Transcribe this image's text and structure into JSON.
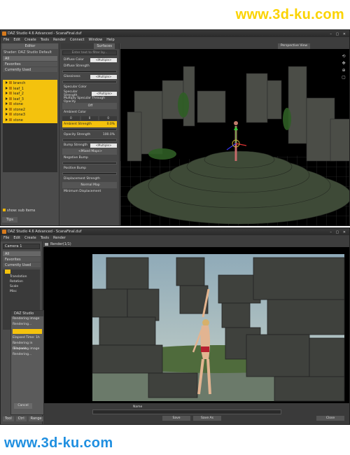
{
  "watermark_top": "www.3d-ku.com",
  "watermark_bottom": "www.3d-ku.com",
  "shot1": {
    "window_title": "DAZ Studio 4.6 Advanced - ScanaFinal.duf",
    "menu": [
      "File",
      "Edit",
      "Create",
      "Tools",
      "Render",
      "Connect",
      "Window",
      "Help"
    ],
    "left_panel": {
      "tab": "Editor",
      "shader_label": "Shader: DAZ Studio Default",
      "filters": [
        "All",
        "Favorites",
        "Currently Used"
      ],
      "tree_items": [
        "branch",
        "leaf_1",
        "leaf_2",
        "leaf_3",
        "stone",
        "stone2",
        "stone3",
        "stone"
      ],
      "footer_check": "show: sub items",
      "bottom_tab": "Tips"
    },
    "surfaces_panel": {
      "tab": "Surfaces",
      "search_placeholder": "Enter text to filter by...",
      "props": [
        {
          "label": "Diffuse Color",
          "value": "<Multiple>"
        },
        {
          "label": "Diffuse Strength",
          "value": ""
        },
        {
          "label": "Glossiness",
          "value": "<Multiple>"
        },
        {
          "label": "Specular Color",
          "value": ""
        },
        {
          "label": "Specular Strength",
          "value": "<Multiple>"
        },
        {
          "label": "Multiply Specular Through Opacity",
          "value": ""
        },
        {
          "label": "Ambient Color",
          "value": ""
        },
        {
          "label": "Ambient Strength",
          "value": "0.0%"
        },
        {
          "label": "Opacity Strength",
          "value": "100.0%"
        },
        {
          "label": "Bump Strength",
          "value": "<Multiple>"
        },
        {
          "label": "Negative Bump",
          "value": ""
        },
        {
          "label": "Positive Bump",
          "value": ""
        },
        {
          "label": "Displacement Strength",
          "value": ""
        },
        {
          "label": "Minimum Displacement",
          "value": ""
        }
      ],
      "ambient_rgb": [
        "0",
        "0",
        "0"
      ],
      "group_off": "Off",
      "group_bump": "<Mixed Maps>",
      "group_normal": "Normal Map"
    },
    "viewport": {
      "view_menu": "Perspective View"
    }
  },
  "shot2": {
    "window_title": "DAZ Studio 4.6 Advanced - ScanaFinal.duf",
    "menu": [
      "File",
      "Edit",
      "Create",
      "Tools",
      "Render"
    ],
    "left_panel": {
      "camera_dropdown": "Camera 1",
      "filters": [
        "All",
        "Favorites",
        "Currently Used"
      ],
      "scene_items": [
        "Translation",
        "Rotation",
        "Scale",
        "Misc"
      ],
      "bottom_tabs": [
        "Tool",
        "Ctrl",
        "Range"
      ]
    },
    "render_dialog": {
      "title": "DAZ Studio",
      "line1": "Rendering image",
      "line2": "Rendering...",
      "elapsed": "Elapsed Time: 1h ...",
      "log1": "Rendering in (Elapsed...",
      "log2": "Rendering image",
      "log3": "Rendering...",
      "cancel": "Cancel",
      "extra": "Metrics"
    },
    "render_window": {
      "title": "Render(1/1)",
      "name_label": "Name",
      "buttons": [
        "Save",
        "Save As",
        "Close"
      ]
    }
  }
}
